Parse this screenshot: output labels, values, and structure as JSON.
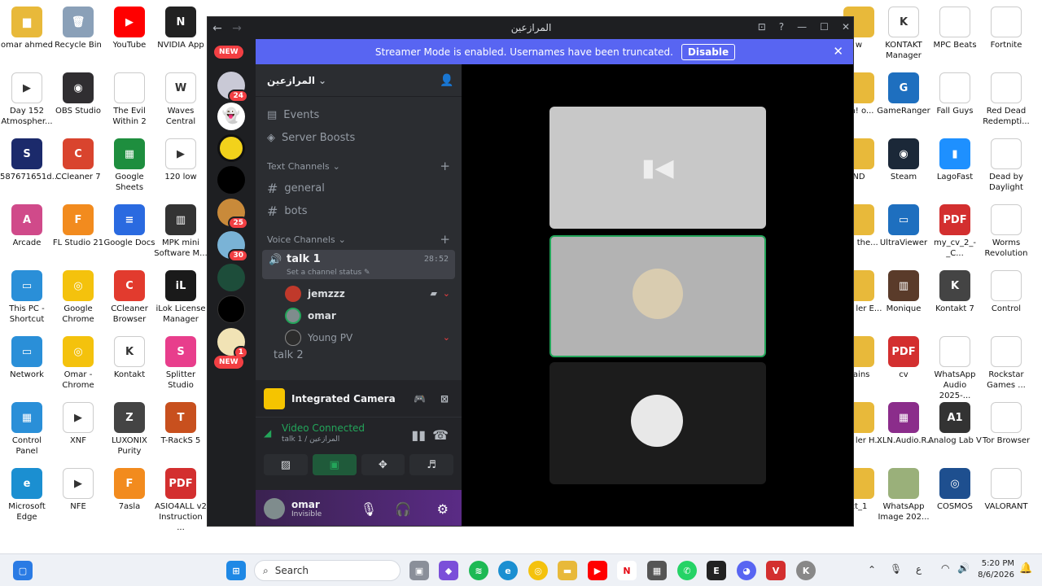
{
  "desktop_icons": [
    {
      "label": "omar ahmed",
      "color": "#e8b93a",
      "glyph": "▆"
    },
    {
      "label": "Recycle Bin",
      "color": "#8aa0b8",
      "glyph": "🗑"
    },
    {
      "label": "YouTube",
      "color": "#ff0000",
      "glyph": "▶"
    },
    {
      "label": "NVIDIA App",
      "color": "#222222",
      "glyph": "N"
    },
    {
      "label": "Day 152 Atmospher...",
      "color": "#ffffff",
      "glyph": "▶"
    },
    {
      "label": "OBS Studio",
      "color": "#302e31",
      "glyph": "◉"
    },
    {
      "label": "The Evil Within 2",
      "color": "#ffffff",
      "glyph": ""
    },
    {
      "label": "Waves Central",
      "color": "#ffffff",
      "glyph": "W"
    },
    {
      "label": "587671651d...",
      "color": "#1b2a6b",
      "glyph": "S"
    },
    {
      "label": "CCleaner 7",
      "color": "#d9442e",
      "glyph": "C"
    },
    {
      "label": "Google Sheets",
      "color": "#1e8e3e",
      "glyph": "▦"
    },
    {
      "label": "120 low",
      "color": "#ffffff",
      "glyph": "▶"
    },
    {
      "label": "Arcade",
      "color": "#d04a8a",
      "glyph": "A"
    },
    {
      "label": "FL Studio 21",
      "color": "#f28b1e",
      "glyph": "F"
    },
    {
      "label": "Google Docs",
      "color": "#2a6ae0",
      "glyph": "≡"
    },
    {
      "label": "MPK mini Software M...",
      "color": "#333333",
      "glyph": "▥"
    },
    {
      "label": "This PC - Shortcut",
      "color": "#2a8fd8",
      "glyph": "▭"
    },
    {
      "label": "Google Chrome",
      "color": "#f4c20d",
      "glyph": "◎"
    },
    {
      "label": "CCleaner Browser",
      "color": "#e23b2e",
      "glyph": "C"
    },
    {
      "label": "iLok License Manager",
      "color": "#1a1a1a",
      "glyph": "iL"
    },
    {
      "label": "Network",
      "color": "#2a8fd8",
      "glyph": "▭"
    },
    {
      "label": "Omar - Chrome",
      "color": "#f4c20d",
      "glyph": "◎"
    },
    {
      "label": "Kontakt",
      "color": "#ffffff",
      "glyph": "K"
    },
    {
      "label": "Splitter Studio",
      "color": "#e83e8c",
      "glyph": "S"
    },
    {
      "label": "Control Panel",
      "color": "#2a8fd8",
      "glyph": "▦"
    },
    {
      "label": "XNF",
      "color": "#ffffff",
      "glyph": "▶"
    },
    {
      "label": "LUXONIX Purity",
      "color": "#444444",
      "glyph": "Z"
    },
    {
      "label": "T-RackS 5",
      "color": "#c8501e",
      "glyph": "T"
    },
    {
      "label": "Microsoft Edge",
      "color": "#1b8fd1",
      "glyph": "e"
    },
    {
      "label": "NFE",
      "color": "#ffffff",
      "glyph": "▶"
    },
    {
      "label": "7asla",
      "color": "#f28b1e",
      "glyph": "F"
    },
    {
      "label": "ASIO4ALL v2 Instruction ...",
      "color": "#d32f2f",
      "glyph": "PDF"
    },
    {
      "label": "w",
      "color": "#e8b93a",
      "glyph": ""
    },
    {
      "label": "KONTAKT Manager",
      "color": "#ffffff",
      "glyph": "K"
    },
    {
      "label": "MPC Beats",
      "color": "#ffffff",
      "glyph": ""
    },
    {
      "label": "Fortnite",
      "color": "#ffffff",
      "glyph": ""
    },
    {
      "label": "Oh! o...",
      "color": "#e8b93a",
      "glyph": ""
    },
    {
      "label": "GameRanger",
      "color": "#1e6fbf",
      "glyph": "G"
    },
    {
      "label": "Fall Guys",
      "color": "#ffffff",
      "glyph": ""
    },
    {
      "label": "Red Dead Redempti...",
      "color": "#ffffff",
      "glyph": ""
    },
    {
      "label": "ND",
      "color": "#e8b93a",
      "glyph": ""
    },
    {
      "label": "Steam",
      "color": "#1b2838",
      "glyph": "◉"
    },
    {
      "label": "LagoFast",
      "color": "#1e90ff",
      "glyph": "▮"
    },
    {
      "label": "Dead by Daylight",
      "color": "#ffffff",
      "glyph": ""
    },
    {
      "label": "Oh! the...",
      "color": "#e8b93a",
      "glyph": ""
    },
    {
      "label": "UltraViewer",
      "color": "#1e6fbf",
      "glyph": "▭"
    },
    {
      "label": "my_cv_2_-_C...",
      "color": "#d32f2f",
      "glyph": "PDF"
    },
    {
      "label": "Worms Revolution",
      "color": "#ffffff",
      "glyph": ""
    },
    {
      "label": "hold ler E...",
      "color": "#e8b93a",
      "glyph": ""
    },
    {
      "label": "Monique",
      "color": "#5a3b2a",
      "glyph": "▥"
    },
    {
      "label": "Kontakt 7",
      "color": "#444444",
      "glyph": "K"
    },
    {
      "label": "Control",
      "color": "#ffffff",
      "glyph": ""
    },
    {
      "label": "hains",
      "color": "#e8b93a",
      "glyph": ""
    },
    {
      "label": "cv",
      "color": "#d32f2f",
      "glyph": "PDF"
    },
    {
      "label": "WhatsApp Audio 2025-...",
      "color": "#ffffff",
      "glyph": ""
    },
    {
      "label": "Rockstar Games ...",
      "color": "#ffffff",
      "glyph": ""
    },
    {
      "label": "hold ler H...",
      "color": "#e8b93a",
      "glyph": ""
    },
    {
      "label": "XLN.Audio.R...",
      "color": "#8b2d8b",
      "glyph": "▦"
    },
    {
      "label": "Analog Lab V",
      "color": "#333333",
      "glyph": "A1"
    },
    {
      "label": "Tor Browser",
      "color": "#ffffff",
      "glyph": ""
    },
    {
      "label": "ct_1",
      "color": "#e8b93a",
      "glyph": ""
    },
    {
      "label": "WhatsApp Image 202...",
      "color": "#9ab07a",
      "glyph": ""
    },
    {
      "label": "COSMOS",
      "color": "#1e4f8f",
      "glyph": "◎"
    },
    {
      "label": "VALORANT",
      "color": "#ffffff",
      "glyph": ""
    }
  ],
  "window": {
    "title": "المرازعين",
    "back": "←",
    "forward": "→",
    "controls": [
      "⊡",
      "?",
      "—",
      "☐",
      "✕"
    ]
  },
  "banner": {
    "text": "Streamer Mode is enabled. Usernames have been truncated.",
    "button": "Disable",
    "close": "✕"
  },
  "guilds": {
    "new_top": "NEW",
    "new_bottom": "NEW",
    "badges": [
      "24",
      "25",
      "30",
      "1"
    ]
  },
  "server": {
    "name": "المرازعين",
    "menu": [
      {
        "icon": "▤",
        "label": "Events"
      },
      {
        "icon": "◈",
        "label": "Server Boosts"
      }
    ],
    "text_category": "Text Channels",
    "text_channels": [
      "general",
      "bots"
    ],
    "voice_category": "Voice Channels",
    "voice_channel": {
      "name": "talk 1",
      "status": "Set a channel status",
      "timer": "28:52",
      "users": [
        {
          "name": "jemzzz",
          "color": "#c0392b"
        },
        {
          "name": "omar",
          "color": "#7f8c8d"
        },
        {
          "name": "Young PV",
          "color": "#2c2c2c"
        }
      ]
    },
    "next_channel": "talk 2"
  },
  "panel": {
    "camera_label": "Integrated Camera",
    "connection_status": "Video Connected",
    "connection_sub": "talk 1 / المرازعين",
    "user_name": "omar",
    "user_status": "Invisible"
  },
  "colors": {
    "blurple": "#5865f2",
    "green": "#23a55a",
    "red": "#f23f43"
  },
  "taskbar": {
    "search": "Search",
    "time": "5:20 PM",
    "date": "8/6/2026",
    "lang": "ع"
  }
}
